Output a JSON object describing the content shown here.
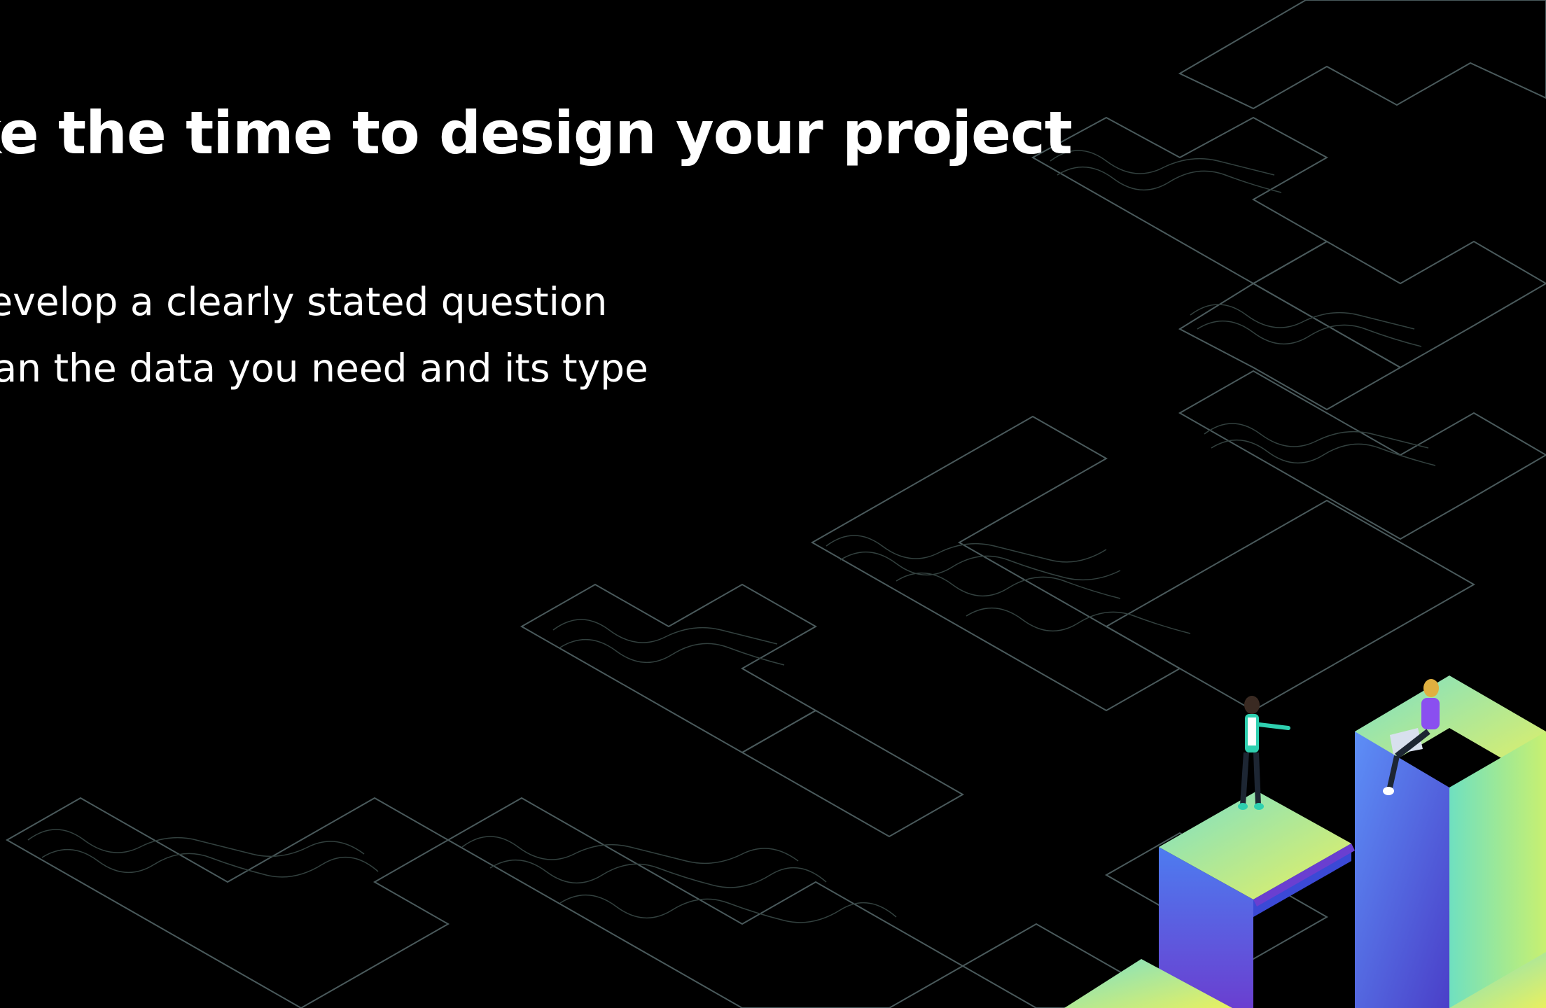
{
  "slide": {
    "title": "Take the time to design your project",
    "bullets": [
      "Develop a clearly stated question",
      "Plan the data you need and its type"
    ]
  },
  "colors": {
    "background": "#000000",
    "text": "#ffffff",
    "contour_line": "#4a5a5c",
    "pillar_gradient_top": [
      "#7be0c8",
      "#e8f060"
    ],
    "pillar_gradient_side": [
      "#4f63e6",
      "#6a3fd0"
    ]
  },
  "decoration": {
    "pattern": "isometric-topographic-contour-tiles",
    "figures": [
      "person-standing-pointing",
      "person-sitting-with-laptop"
    ]
  }
}
